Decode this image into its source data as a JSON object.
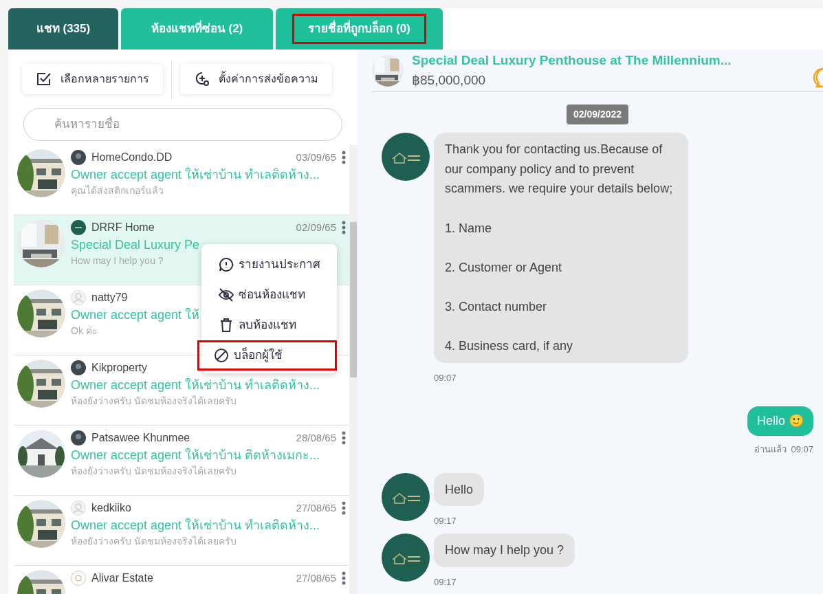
{
  "tabs": [
    {
      "label": "แชท (335)",
      "selected": true,
      "highlighted": false
    },
    {
      "label": "ห้องแชทที่ซ่อน (2)",
      "selected": false,
      "highlighted": false
    },
    {
      "label": "รายชื่อที่ถูกบล็อก (0)",
      "selected": false,
      "highlighted": true
    }
  ],
  "toolbar": [
    {
      "label": "เลือกหลายรายการ",
      "kind": "multi-select"
    },
    {
      "label": "ตั้งค่าการส่งข้อความ",
      "kind": "message-settings"
    }
  ],
  "search": {
    "placeholder": "ค้นหารายชื่อ"
  },
  "chats": [
    {
      "name": "HomeCondo.DD",
      "date": "03/09/65",
      "title": "Owner accept agent ให้เช่าบ้าน ทำเลติดห้าง...",
      "last_message": "คุณได้ส่งสติกเกอร์แล้ว",
      "selected": false
    },
    {
      "name": "DRRF Home",
      "date": "02/09/65",
      "title": "Special Deal Luxury Pe",
      "last_message": "How may I help you ?",
      "selected": true
    },
    {
      "name": "natty79",
      "title": "Owner accept agent ให้",
      "last_message": "Ok ค่ะ",
      "selected": false
    },
    {
      "name": "Kikproperty",
      "title": "Owner accept agent ให้เช่าบ้าน ทำเลติดห้าง...",
      "last_message": "ห้องยังว่างครับ นัดชมห้องจริงได้เลยครับ",
      "selected": false
    },
    {
      "name": "Patsawee Khunmee",
      "date": "28/08/65",
      "title": "Owner accept agent ให้เช่าบ้าน ติดห้างเมกะ...",
      "last_message": "ห้องยังว่างครับ นัดชมห้องจริงได้เลยครับ",
      "selected": false
    },
    {
      "name": "kedkiiko",
      "date": "27/08/65",
      "title": "Owner accept agent ให้เช่าบ้าน ทำเลติดห้าง...",
      "last_message": "ห้องยังว่างครับ นัดชมห้องจริงได้เลยครับ",
      "selected": false
    },
    {
      "name": "Alivar Estate",
      "date": "27/08/65",
      "selected": false
    }
  ],
  "context_menu": [
    {
      "label": "รายงานประกาศ",
      "kind": "report",
      "highlighted": false
    },
    {
      "label": "ซ่อนห้องแชท",
      "kind": "hide",
      "highlighted": false
    },
    {
      "label": "ลบห้องแชท",
      "kind": "delete",
      "highlighted": false
    },
    {
      "label": "บล็อกผู้ใช้",
      "kind": "block",
      "highlighted": true
    }
  ],
  "listing": {
    "title": "Special Deal Luxury Penthouse at The Millennium...",
    "price": "฿85,000,000"
  },
  "date_badge": "02/09/2022",
  "messages": [
    {
      "kind": "incoming",
      "text": "Thank you for contacting us.Because of our company policy and to prevent scammers. we require your details below;\n\n1. Name\n\n2. Customer or Agent\n\n3. Contact number\n\n4. Business card, if any",
      "time": "09:07"
    },
    {
      "kind": "outgoing",
      "text": "Hello 🙂",
      "status": "อ่านแล้ว",
      "time": "09:07"
    },
    {
      "kind": "incoming",
      "text": "Hello",
      "time": "09:17"
    },
    {
      "kind": "incoming",
      "text": "How may I help you ?",
      "time": "09:17"
    }
  ]
}
